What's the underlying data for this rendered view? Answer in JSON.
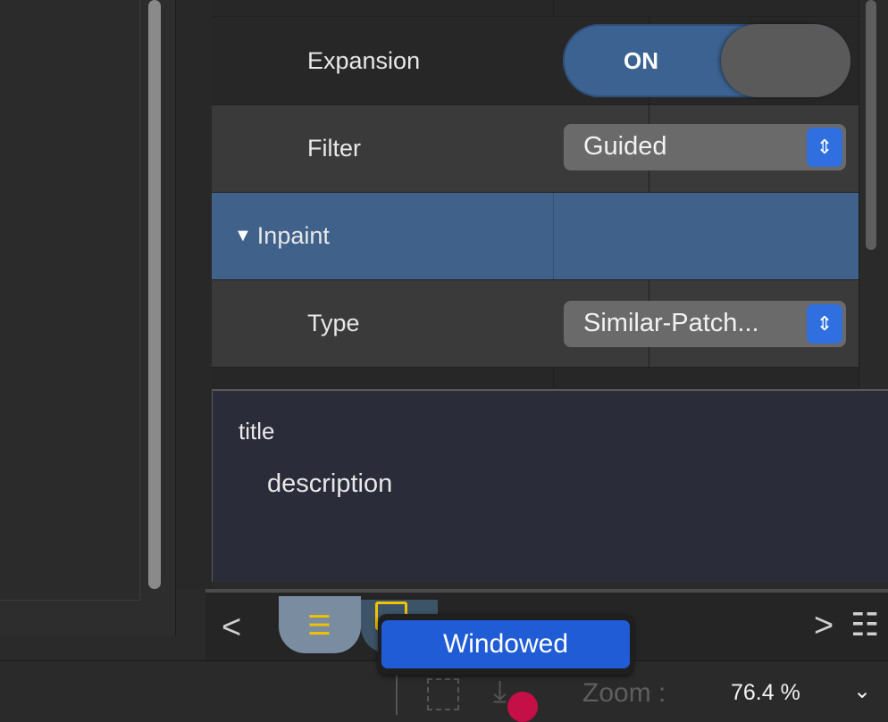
{
  "properties": {
    "expansion": {
      "label": "Expansion",
      "value": "ON"
    },
    "filter": {
      "label": "Filter",
      "value": "Guided"
    },
    "inpaint": {
      "group_label": "Inpaint",
      "disclosure": "▼"
    },
    "type": {
      "label": "Type",
      "value": "Similar-Patch..."
    }
  },
  "description": {
    "title": "title",
    "body": "description"
  },
  "tabbar": {
    "left_glyph": "<",
    "right_glyph": ">",
    "list_icon": "list-icon",
    "panel_icon": "panel-icon"
  },
  "tooltip": {
    "text": "Windowed"
  },
  "statusbar": {
    "zoom_label": "Zoom :",
    "zoom_value": "76.4 %",
    "zoom_chevron": "⌄"
  },
  "colors": {
    "accent": "#2f6fe0",
    "selection": "#40618a",
    "toggle_on": "#3c6291",
    "tab_icon": "#f2c200",
    "cursor": "#c40f47"
  }
}
